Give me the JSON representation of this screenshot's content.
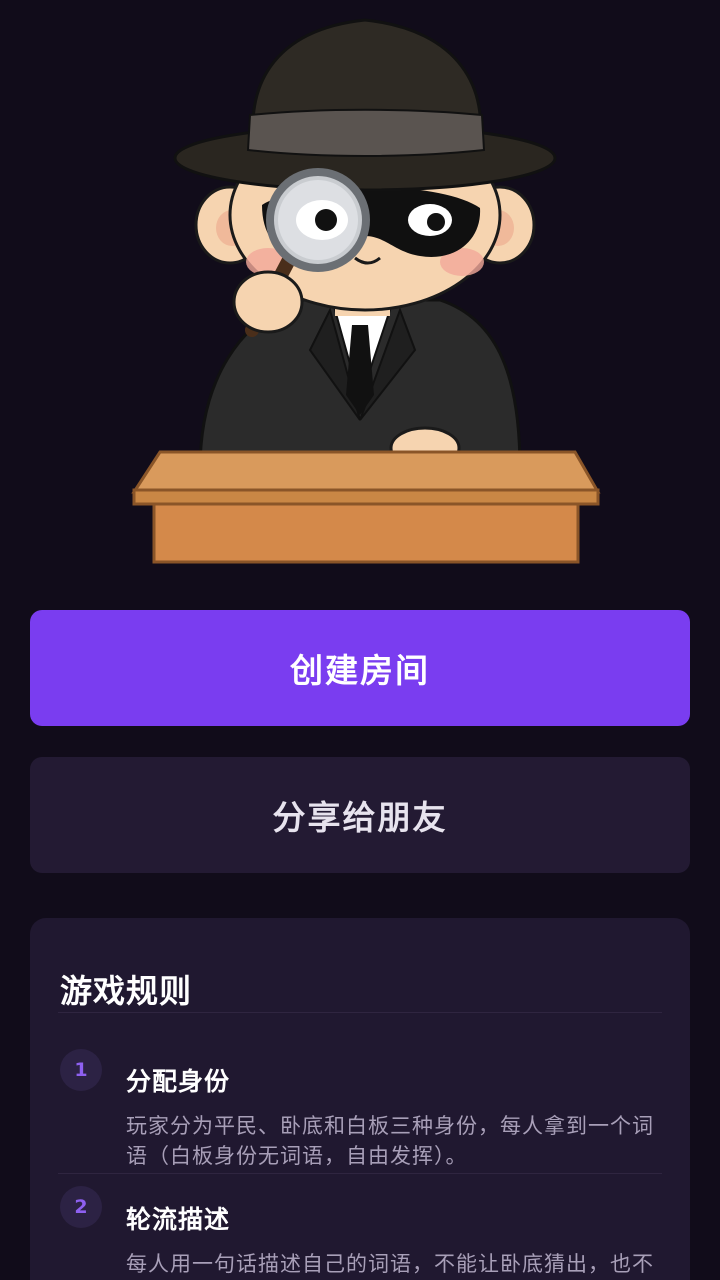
{
  "actions": {
    "create_room_label": "创建房间",
    "share_label": "分享给朋友"
  },
  "rules": {
    "title": "游戏规则",
    "steps": [
      {
        "number": "1",
        "title": "分配身份",
        "description": "玩家分为平民、卧底和白板三种身份，每人拿到一个词语（白板身份无词语，自由发挥）。"
      },
      {
        "number": "2",
        "title": "轮流描述",
        "description": "每人用一句话描述自己的词语，不能让卧底猜出，也不"
      }
    ]
  },
  "colors": {
    "background": "#110c1a",
    "primary_button": "#7a3df0",
    "secondary_button": "#231a33",
    "card": "#201830",
    "step_number": "#8e60f0"
  },
  "icons": {
    "hero": "detective-illustration"
  }
}
